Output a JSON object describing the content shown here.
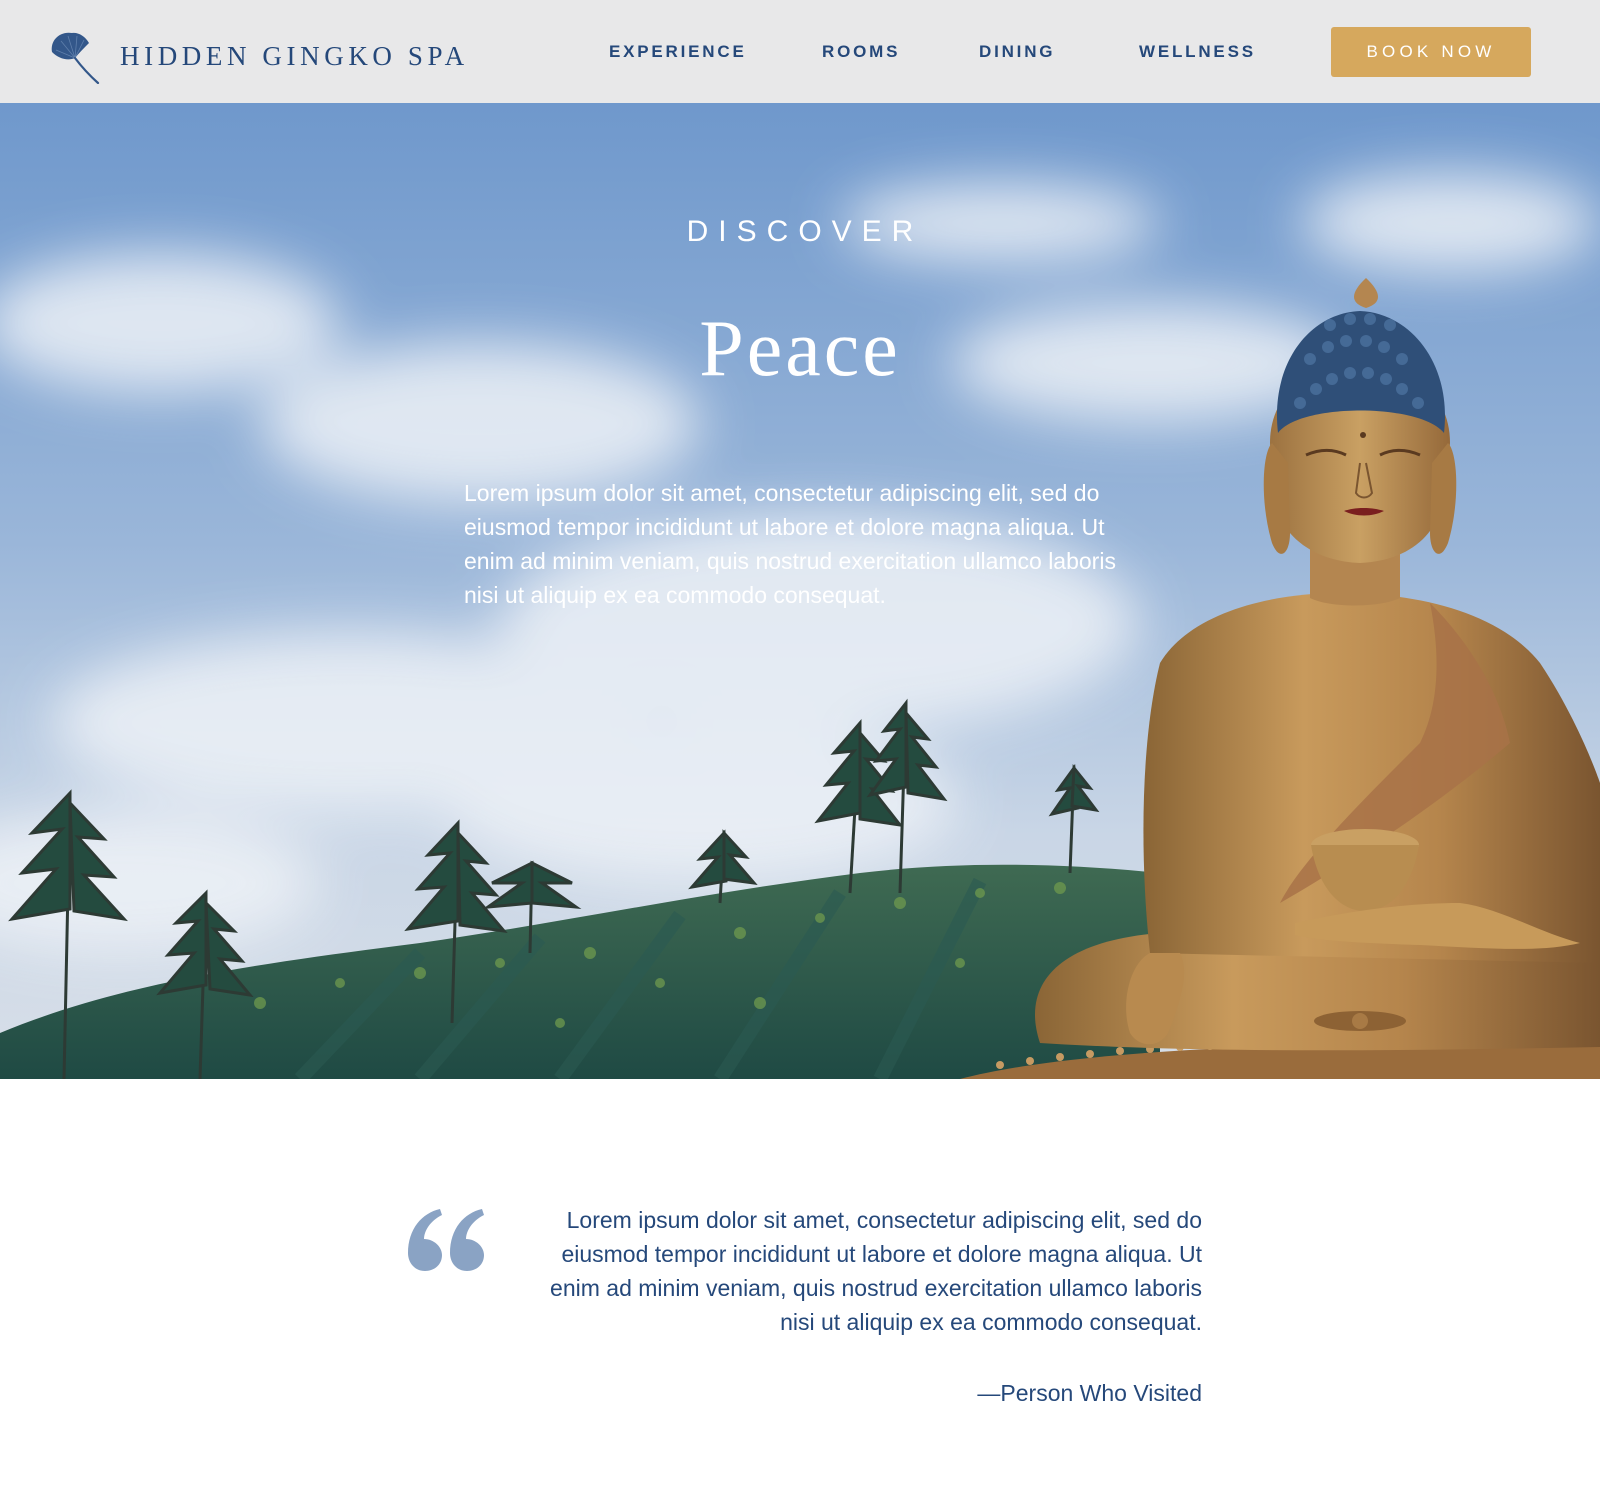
{
  "brand": {
    "name": "HIDDEN GINGKO SPA",
    "logo_icon": "ginkgo-leaf-icon"
  },
  "nav": {
    "items": [
      {
        "label": "EXPERIENCE"
      },
      {
        "label": "ROOMS"
      },
      {
        "label": "DINING"
      },
      {
        "label": "WELLNESS"
      }
    ],
    "cta_label": "BOOK NOW"
  },
  "hero": {
    "eyebrow": "DISCOVER",
    "title": "Peace",
    "body": "Lorem ipsum dolor sit amet, consectetur adipiscing elit, sed do eiusmod tempor incididunt ut labore et dolore magna aliqua. Ut enim ad minim veniam, quis nostrud exercitation ullamco laboris nisi ut aliquip ex ea commodo consequat.",
    "image": "golden-buddha-statue-sky-hillside"
  },
  "testimonial": {
    "icon": "quote-mark-icon",
    "quote": "Lorem ipsum dolor sit amet, consectetur adipiscing elit, sed do eiusmod tempor incididunt ut labore et dolore magna aliqua. Ut enim ad minim veniam, quis nostrud exercitation ullamco laboris nisi ut aliquip ex ea commodo consequat.",
    "author": "—Person Who Visited"
  },
  "colors": {
    "header_bg": "#e8e8e9",
    "navy": "#25487a",
    "gold": "#d6a85d",
    "quote_icon": "#8aa3c4",
    "white": "#ffffff"
  }
}
